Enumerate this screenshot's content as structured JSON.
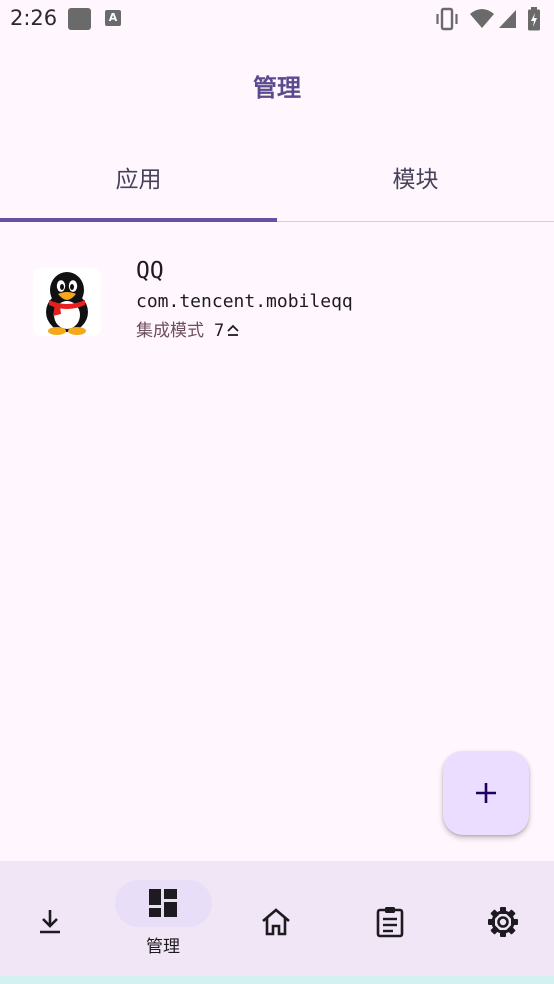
{
  "status_bar": {
    "time": "2:26",
    "left_icons": [
      "app-square-icon",
      "a-badge-icon"
    ],
    "a_badge_text": "A",
    "right_icons": [
      "vibrate-icon",
      "wifi-icon",
      "signal-icon",
      "battery-icon"
    ]
  },
  "top_bar": {
    "title": "管理"
  },
  "tabs": [
    {
      "label": "应用",
      "selected": true
    },
    {
      "label": "模块",
      "selected": false
    }
  ],
  "apps": [
    {
      "name": "QQ",
      "package": "com.tencent.mobileqq",
      "mode": "集成模式",
      "module_count": "7",
      "icon": "qq-penguin-icon"
    }
  ],
  "fab": {
    "icon": "plus-icon"
  },
  "bottom_nav": {
    "items": [
      {
        "icon": "download-icon",
        "label": ""
      },
      {
        "icon": "dashboard-icon",
        "label": "管理",
        "selected": true
      },
      {
        "icon": "home-icon",
        "label": ""
      },
      {
        "icon": "clipboard-icon",
        "label": ""
      },
      {
        "icon": "gear-icon",
        "label": ""
      }
    ]
  },
  "colors": {
    "background": "#FFF7FD",
    "primary": "#6750A4",
    "title": "#5A4A8E",
    "fab": "#EADDFF",
    "nav_background": "#F1E6F5",
    "nav_indicator": "#E8DEF8",
    "mode_text": "#6D4E5E"
  }
}
